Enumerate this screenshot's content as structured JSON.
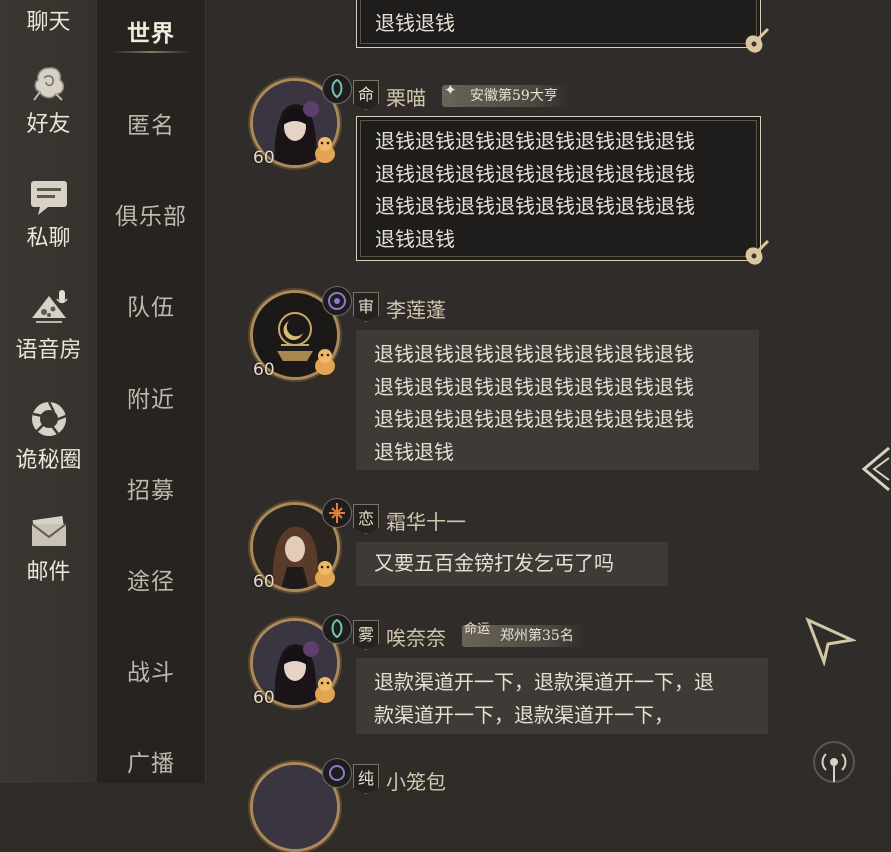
{
  "left_rail": {
    "items": [
      {
        "label": "聊天",
        "icon": "chat-icon"
      },
      {
        "label": "好友",
        "icon": "friends-rose-icon"
      },
      {
        "label": "私聊",
        "icon": "private-message-icon"
      },
      {
        "label": "语音房",
        "icon": "voice-room-icon"
      },
      {
        "label": "诡秘圈",
        "icon": "mystery-circle-icon"
      },
      {
        "label": "邮件",
        "icon": "mail-icon"
      }
    ]
  },
  "channels": {
    "items": [
      {
        "label": "世界",
        "active": true
      },
      {
        "label": "匿名"
      },
      {
        "label": "俱乐部"
      },
      {
        "label": "队伍"
      },
      {
        "label": "附近"
      },
      {
        "label": "招募"
      },
      {
        "label": "途径"
      },
      {
        "label": "战斗"
      },
      {
        "label": "广播"
      }
    ]
  },
  "messages": [
    {
      "lines": [
        "退钱退钱"
      ],
      "style": "framed"
    },
    {
      "level": "60",
      "tag": "命",
      "name": "栗喵",
      "badge": "安徽第59大亨",
      "lines": [
        "退钱退钱退钱退钱退钱退钱退钱退钱",
        "退钱退钱退钱退钱退钱退钱退钱退钱",
        "退钱退钱退钱退钱退钱退钱退钱退钱",
        "退钱退钱"
      ],
      "style": "framed"
    },
    {
      "level": "60",
      "tag": "审",
      "name": "李莲蓬",
      "lines": [
        "退钱退钱退钱退钱退钱退钱退钱退钱",
        "退钱退钱退钱退钱退钱退钱退钱退钱",
        "退钱退钱退钱退钱退钱退钱退钱退钱",
        "退钱退钱"
      ],
      "style": "plain"
    },
    {
      "level": "60",
      "tag": "恋",
      "name": "霜华十一",
      "lines": [
        "又要五百金镑打发乞丐了吗"
      ],
      "style": "plain"
    },
    {
      "level": "60",
      "tag": "雾",
      "name": "唉奈奈",
      "badge_prefix": "命运",
      "badge": "郑州第35名",
      "lines": [
        "退款渠道开一下，退款渠道开一下，退",
        "款渠道开一下，退款渠道开一下，"
      ],
      "style": "plain"
    },
    {
      "tag": "纯",
      "name": "小笼包"
    }
  ],
  "colors": {
    "background": "#2f2c28",
    "rail": "#38342f",
    "channels": "#262320",
    "bubble_plain": "#3e3b36",
    "bubble_framed": "#1f1d1b",
    "avatar_ring": "#a98b5a"
  }
}
